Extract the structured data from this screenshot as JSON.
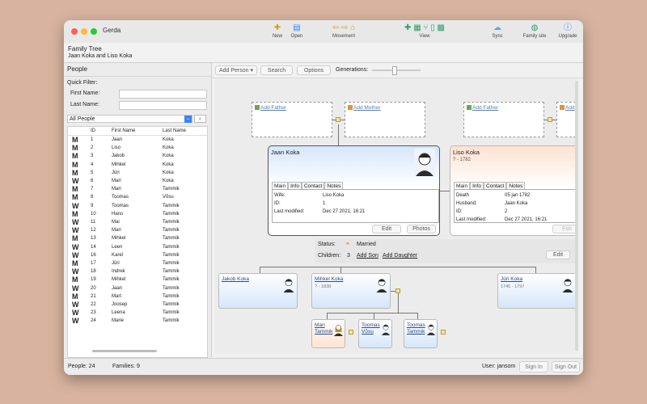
{
  "window": {
    "title": "Gerda"
  },
  "toolbar": {
    "new": "New",
    "open": "Open",
    "movement": "Movement",
    "view": "View",
    "sync": "Sync",
    "family_site": "Family site",
    "upgrade": "Upgrade"
  },
  "header": {
    "title": "Family Tree",
    "subtitle": "Jaan Koka and Liso Koka"
  },
  "sidebar": {
    "title": "People",
    "quick_filter": "Quick Filter:",
    "first_name_label": "First Name:",
    "last_name_label": "Last Name:",
    "first_name_value": "",
    "last_name_value": "",
    "filter_select": "All People",
    "columns": {
      "id": "ID",
      "first": "First Name",
      "last": "Last Name"
    },
    "people": [
      {
        "g": "M",
        "id": "1",
        "first": "Jaan",
        "last": "Koka"
      },
      {
        "g": "M",
        "id": "2",
        "first": "Liso",
        "last": "Koka"
      },
      {
        "g": "M",
        "id": "3",
        "first": "Jakob",
        "last": "Koka"
      },
      {
        "g": "M",
        "id": "4",
        "first": "Mihkel",
        "last": "Koka"
      },
      {
        "g": "M",
        "id": "5",
        "first": "Jüri",
        "last": "Koka"
      },
      {
        "g": "W",
        "id": "6",
        "first": "Mari",
        "last": "Koka"
      },
      {
        "g": "M",
        "id": "7",
        "first": "Mari",
        "last": "Tammik"
      },
      {
        "g": "M",
        "id": "8",
        "first": "Toomas",
        "last": "Võsu"
      },
      {
        "g": "W",
        "id": "9",
        "first": "Toomas",
        "last": "Tammik"
      },
      {
        "g": "M",
        "id": "10",
        "first": "Hans",
        "last": "Tammik"
      },
      {
        "g": "W",
        "id": "11",
        "first": "Mai",
        "last": "Tammik"
      },
      {
        "g": "W",
        "id": "12",
        "first": "Mari",
        "last": "Tammik"
      },
      {
        "g": "M",
        "id": "13",
        "first": "Mihkel",
        "last": "Tammik"
      },
      {
        "g": "W",
        "id": "14",
        "first": "Leen",
        "last": "Tammik"
      },
      {
        "g": "W",
        "id": "16",
        "first": "Karel",
        "last": "Tammik"
      },
      {
        "g": "M",
        "id": "17",
        "first": "Jüri",
        "last": "Tammik"
      },
      {
        "g": "W",
        "id": "18",
        "first": "Indrek",
        "last": "Tammik"
      },
      {
        "g": "M",
        "id": "19",
        "first": "Mihkel",
        "last": "Tammik"
      },
      {
        "g": "W",
        "id": "20",
        "first": "Jaan",
        "last": "Tammik"
      },
      {
        "g": "M",
        "id": "21",
        "first": "Mart",
        "last": "Tammik"
      },
      {
        "g": "W",
        "id": "22",
        "first": "Joosep",
        "last": "Tammik"
      },
      {
        "g": "W",
        "id": "23",
        "first": "Leena",
        "last": "Tammik"
      },
      {
        "g": "W",
        "id": "24",
        "first": "Marie",
        "last": "Tammik"
      }
    ]
  },
  "main": {
    "add_person": "Add Person",
    "search": "Search",
    "options": "Options",
    "generations": "Generations:",
    "generations_level": 0.45,
    "add_father": "Add Father",
    "add_mother": "Add Mother",
    "add_father2": "Add Father",
    "add_cut": "Add",
    "husband": {
      "name": "Jaan Koka",
      "tabs": [
        "Main",
        "Info",
        "Contact",
        "Notes"
      ],
      "fields": [
        {
          "k": "Wife:",
          "v": "Liso Koka"
        },
        {
          "k": "ID:",
          "v": "1"
        },
        {
          "k": "Last modified:",
          "v": "Dec 27 2021, 16:21"
        }
      ],
      "edit": "Edit",
      "photos": "Photos"
    },
    "wife": {
      "name": "Liso Koka",
      "dates": "? - 1782",
      "tabs": [
        "Main",
        "Info",
        "Contact",
        "Notes"
      ],
      "fields": [
        {
          "k": "Death",
          "v": "05 jan 1782"
        },
        {
          "k": "Husband:",
          "v": "Jaan Koka"
        },
        {
          "k": "ID:",
          "v": "2"
        },
        {
          "k": "Last modified:",
          "v": "Dec 27 2021, 16:21"
        }
      ],
      "edit": "Edit"
    },
    "family": {
      "status_label": "Status:",
      "status": "Married",
      "children_label": "Children:",
      "children_count": "3",
      "add_son": "Add Son",
      "add_daughter": "Add Daughter",
      "edit": "Edit"
    },
    "children": [
      {
        "name": "Jakob Koka",
        "dates": ""
      },
      {
        "name": "Mihkel Koka",
        "dates": "? - 1838"
      },
      {
        "name": "Jüri Koka",
        "dates": "1745 - 1797"
      }
    ],
    "grandchildren": [
      {
        "name": "Mari Tammik"
      },
      {
        "name": "Toomas Võsu"
      },
      {
        "name": "Toomas Tammik"
      }
    ]
  },
  "status": {
    "people": "People: 24",
    "families": "Families: 9",
    "user": "User: jansom",
    "sign_in": "Sign In",
    "sign_out": "Sign Out"
  },
  "colors": {
    "male_card": "#d6e6fb",
    "female_card": "#fde2d0",
    "accent": "#3b82f6",
    "green": "#2e9e6a"
  }
}
